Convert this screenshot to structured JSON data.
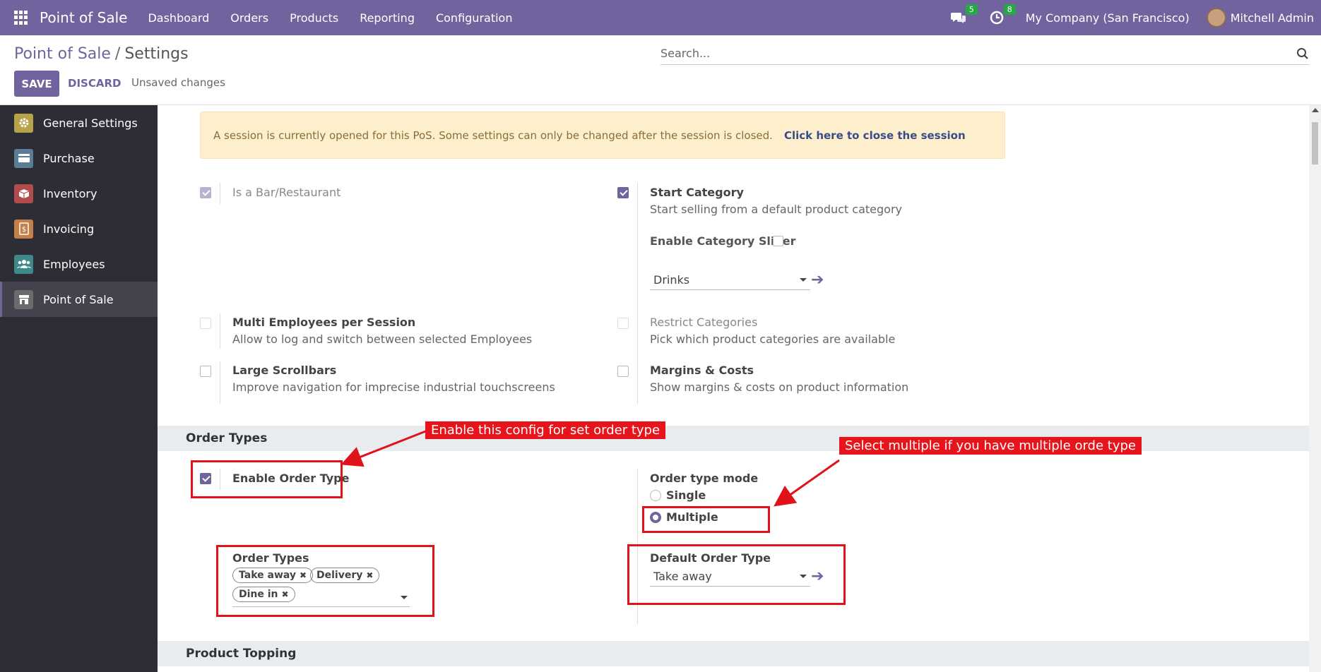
{
  "navbar": {
    "brand": "Point of Sale",
    "menu": [
      "Dashboard",
      "Orders",
      "Products",
      "Reporting",
      "Configuration"
    ],
    "messages_count": "5",
    "activities_count": "8",
    "company": "My Company (San Francisco)",
    "user": "Mitchell Admin"
  },
  "control": {
    "breadcrumb_root": "Point of Sale",
    "breadcrumb_sep": "/",
    "breadcrumb_current": "Settings",
    "search_placeholder": "Search...",
    "save": "SAVE",
    "discard": "DISCARD",
    "unsaved": "Unsaved changes"
  },
  "sidebar": {
    "items": [
      {
        "label": "General Settings",
        "color": "#b7a34a"
      },
      {
        "label": "Purchase",
        "color": "#5b7d96"
      },
      {
        "label": "Inventory",
        "color": "#b24b4b"
      },
      {
        "label": "Invoicing",
        "color": "#c77f4a"
      },
      {
        "label": "Employees",
        "color": "#3e8a8a"
      },
      {
        "label": "Point of Sale",
        "color": "#6b6b6b"
      }
    ]
  },
  "alert": {
    "text": "A session is currently opened for this PoS. Some settings can only be changed after the session is closed.",
    "link": "Click here to close the session"
  },
  "settings": {
    "bar_restaurant": {
      "title": "Is a Bar/Restaurant"
    },
    "start_category": {
      "title": "Start Category",
      "desc": "Start selling from a default product category",
      "slider_label": "Enable Category Slider",
      "category_value": "Drinks"
    },
    "multi_employees": {
      "title": "Multi Employees per Session",
      "desc": "Allow to log and switch between selected Employees"
    },
    "restrict_categories": {
      "title": "Restrict Categories",
      "desc": "Pick which product categories are available"
    },
    "large_scrollbars": {
      "title": "Large Scrollbars",
      "desc": "Improve navigation for imprecise industrial touchscreens"
    },
    "margins_costs": {
      "title": "Margins & Costs",
      "desc": "Show margins & costs on product information"
    }
  },
  "order_types_section": {
    "heading": "Order Types",
    "enable_label": "Enable Order Type",
    "mode_label": "Order type mode",
    "mode_options": [
      "Single",
      "Multiple"
    ],
    "mode_selected": "Multiple",
    "types_label": "Order Types",
    "types_tags": [
      "Take away",
      "Delivery",
      "Dine in"
    ],
    "default_label": "Default Order Type",
    "default_value": "Take away"
  },
  "product_topping_section": {
    "heading": "Product Topping"
  },
  "annotations": {
    "enable_note": "Enable this config for set order type",
    "multiple_note": "Select multiple if you have multiple orde type"
  }
}
